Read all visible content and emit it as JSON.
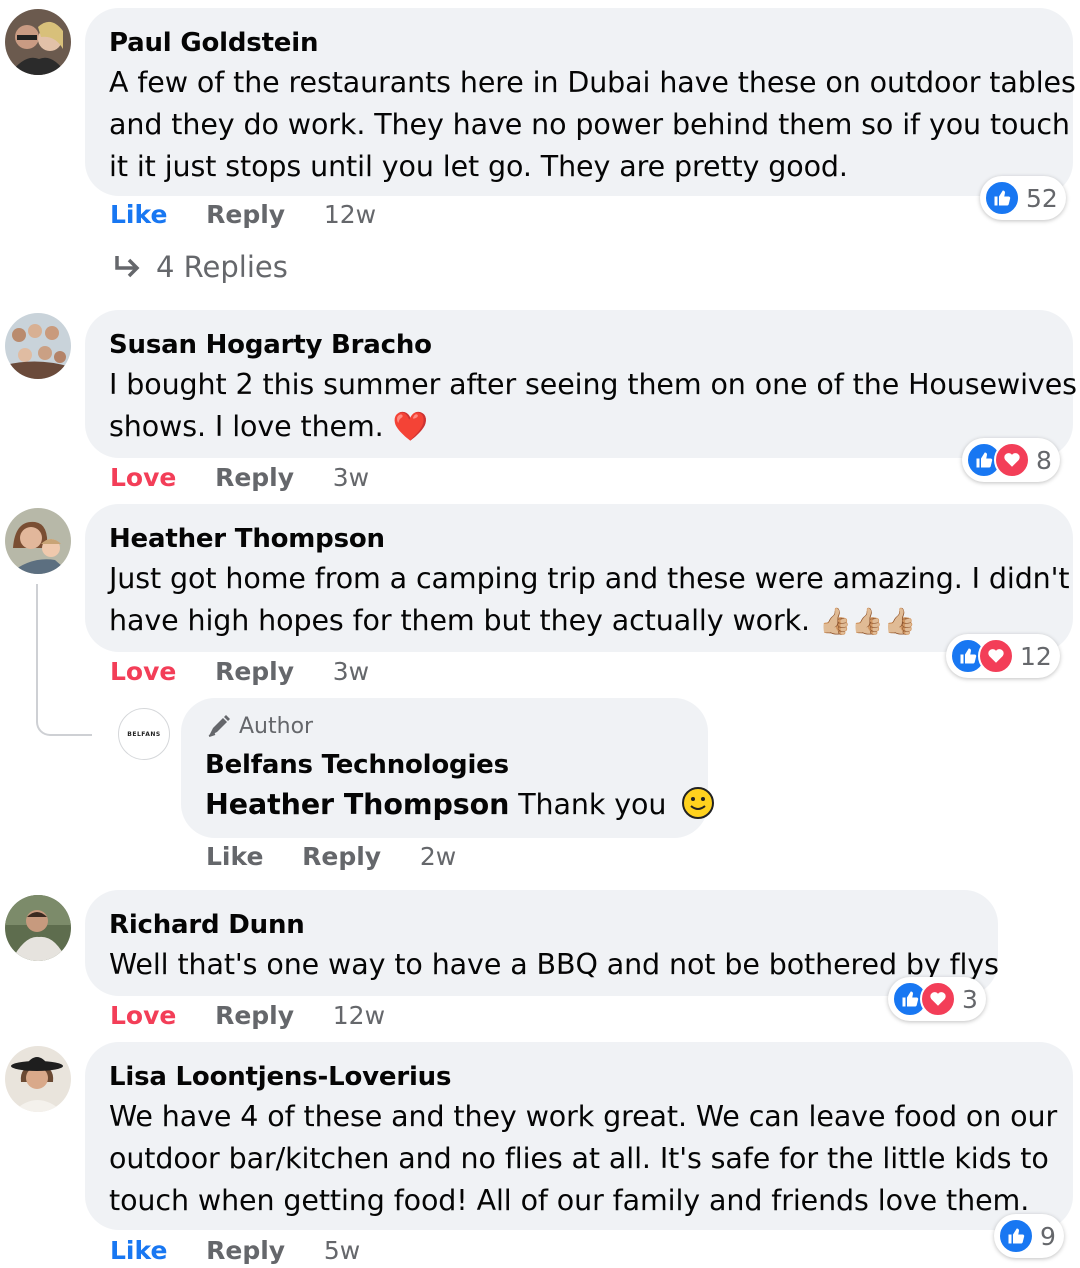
{
  "comments": [
    {
      "name": "Paul Goldstein",
      "lines": [
        "A few of the restaurants here in Dubai have these on outdoor tables",
        "and they do work. They have no power behind them so if you touch",
        "it it just stops until you let go. They are pretty good."
      ],
      "action": "Like",
      "reply": "Reply",
      "time": "12w",
      "reactions": "52",
      "replies_label": "4 Replies"
    },
    {
      "name": "Susan Hogarty Bracho",
      "lines": [
        "I bought 2 this summer after seeing them on one of the Housewives",
        "shows. I love them."
      ],
      "emoji": "❤️",
      "action": "Love",
      "reply": "Reply",
      "time": "3w",
      "reactions": "8"
    },
    {
      "name": "Heather Thompson",
      "lines": [
        "Just got home from a camping trip and these were amazing. I didn't",
        "have high hopes for them but they actually work."
      ],
      "emoji": "👍🏼👍🏼👍🏼",
      "action": "Love",
      "reply": "Reply",
      "time": "3w",
      "reactions": "12",
      "author_reply": {
        "badge": "Author",
        "name": "Belfans Technologies",
        "mention": "Heather Thompson",
        "text": "Thank you",
        "avatar_text": "BELFANS",
        "action": "Like",
        "reply": "Reply",
        "time": "2w"
      }
    },
    {
      "name": "Richard Dunn",
      "lines": [
        "Well that's one way to have a BBQ and not be bothered by flys"
      ],
      "action": "Love",
      "reply": "Reply",
      "time": "12w",
      "reactions": "3"
    },
    {
      "name": "Lisa Loontjens-Loverius",
      "lines": [
        "We have 4 of these and they work great. We can leave food on our",
        "outdoor bar/kitchen and no flies at all. It's safe for the little kids to",
        "touch when getting food! All of our family and friends love them."
      ],
      "action": "Like",
      "reply": "Reply",
      "time": "5w",
      "reactions": "9"
    }
  ],
  "colors": {
    "bubble": "#f0f2f5",
    "like": "#1877f2",
    "love": "#f33e58",
    "meta": "#65676b"
  }
}
